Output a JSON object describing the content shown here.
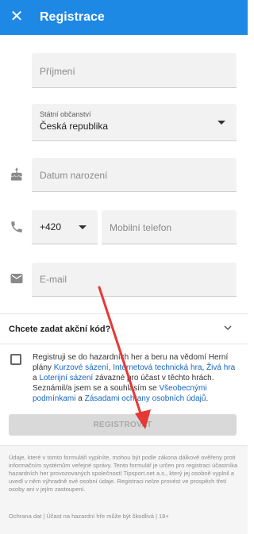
{
  "header": {
    "title": "Registrace",
    "close_icon": "close-icon",
    "background": "#1e88e5"
  },
  "form": {
    "surname_placeholder": "Příjmení",
    "citizenship_label": "Státní občanství",
    "citizenship_value": "Česká republika",
    "birthdate_placeholder": "Datum narození",
    "phone_prefix": "+420",
    "phone_placeholder": "Mobilní telefon",
    "email_placeholder": "E-mail"
  },
  "promo": {
    "label": "Chcete zadat akční kód?"
  },
  "consent": {
    "part1": "Registruji se do hazardních her a beru na vědomí Herní plány ",
    "link1": "Kurzové sázení",
    "sep1": ", ",
    "link2": "Internetová technická hra",
    "sep2": ", ",
    "link3": "Živá hra",
    "sep3": " a ",
    "link4": "Loterijní sázení",
    "part2": " závazné pro účast v těchto hrách. Seznámil/a jsem se a souhlasím se ",
    "link5": "Všeobecnými podmínkami",
    "sep4": " a ",
    "link6": "Zásadami ochrany osobních údajů",
    "end": "."
  },
  "submit": {
    "label": "REGISTROVAT"
  },
  "footer": {
    "notice": "Údaje, které v tomto formuláři vyplníte, mohou být podle zákona dálkově ověřeny proti informačním systémům veřejné správy. Tento formulář je určen pro registraci účastníka hazardních her provozovaných společností Tipsport.net a.s., který jej osobně vyplnil a uvedl v něm výhradně své osobní údaje. Registraci nelze provést ve prospěch třetí osoby ani v jejím zastoupení.",
    "legal": "Ochrana dat | Účast na hazardní hře může být škodlivá | 18+"
  },
  "icons": {
    "birthday": "cake-icon",
    "phone": "phone-icon",
    "email": "email-icon",
    "promo_toggle": "chevron-down-icon"
  },
  "colors": {
    "accent": "#1e88e5",
    "link": "#1565c0",
    "annotation_arrow": "#e53935"
  }
}
